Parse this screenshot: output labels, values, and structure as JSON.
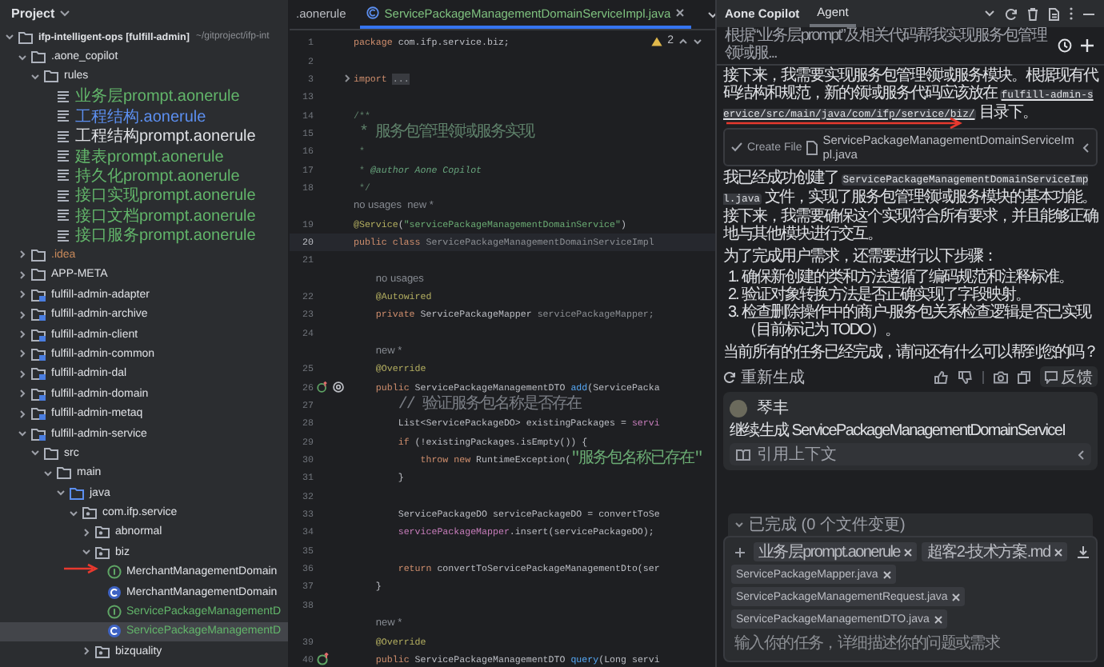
{
  "project_panel": {
    "title": "Project",
    "tree": [
      {
        "name": "ifp-intelligent-ops [fulfill-admin]",
        "path": "~/gitproject/ifp-int",
        "kind": "project",
        "expanded": true,
        "children": [
          {
            "name": ".aone_copilot",
            "kind": "folder",
            "expanded": true,
            "children": [
              {
                "name": "rules",
                "kind": "folder",
                "expanded": true,
                "children": [
                  {
                    "name": "业务层prompt.aonerule",
                    "kind": "rule",
                    "color": "#62b56a"
                  },
                  {
                    "name": "工程结构.aonerule",
                    "kind": "rule",
                    "color": "#5c8ff0"
                  },
                  {
                    "name": "工程结构prompt.aonerule",
                    "kind": "rule",
                    "color": "#dfe1e5"
                  },
                  {
                    "name": "建表prompt.aonerule",
                    "kind": "rule",
                    "color": "#62b56a"
                  },
                  {
                    "name": "持久化prompt.aonerule",
                    "kind": "rule",
                    "color": "#62b56a"
                  },
                  {
                    "name": "接口实现prompt.aonerule",
                    "kind": "rule",
                    "color": "#62b56a"
                  },
                  {
                    "name": "接口文档prompt.aonerule",
                    "kind": "rule",
                    "color": "#62b56a"
                  },
                  {
                    "name": "接口服务prompt.aonerule",
                    "kind": "rule",
                    "color": "#62b56a"
                  }
                ]
              }
            ]
          },
          {
            "name": ".idea",
            "kind": "folder",
            "expanded": false,
            "color": "#c98a5b"
          },
          {
            "name": "APP-META",
            "kind": "folder",
            "expanded": false
          },
          {
            "name": "fulfill-admin-adapter",
            "kind": "module",
            "expanded": false
          },
          {
            "name": "fulfill-admin-archive",
            "kind": "module",
            "expanded": false
          },
          {
            "name": "fulfill-admin-client",
            "kind": "module",
            "expanded": false
          },
          {
            "name": "fulfill-admin-common",
            "kind": "module",
            "expanded": false
          },
          {
            "name": "fulfill-admin-dal",
            "kind": "module",
            "expanded": false
          },
          {
            "name": "fulfill-admin-domain",
            "kind": "module",
            "expanded": false
          },
          {
            "name": "fulfill-admin-metaq",
            "kind": "module",
            "expanded": false
          },
          {
            "name": "fulfill-admin-service",
            "kind": "module",
            "expanded": true,
            "children": [
              {
                "name": "src",
                "kind": "folder",
                "expanded": true,
                "children": [
                  {
                    "name": "main",
                    "kind": "folder",
                    "expanded": true,
                    "children": [
                      {
                        "name": "java",
                        "kind": "source",
                        "expanded": true,
                        "children": [
                          {
                            "name": "com.ifp.service",
                            "kind": "package",
                            "expanded": true,
                            "children": [
                              {
                                "name": "abnormal",
                                "kind": "package",
                                "expanded": false
                              },
                              {
                                "name": "biz",
                                "kind": "package",
                                "expanded": true,
                                "children": [
                                  {
                                    "name": "MerchantManagementDomain",
                                    "kind": "interface",
                                    "selected": false,
                                    "color": "#dfe1e5"
                                  },
                                  {
                                    "name": "MerchantManagementDomain",
                                    "kind": "class",
                                    "selected": false,
                                    "color": "#dfe1e5"
                                  },
                                  {
                                    "name": "ServicePackageManagementD",
                                    "kind": "interface",
                                    "selected": false,
                                    "color": "#62b56a"
                                  },
                                  {
                                    "name": "ServicePackageManagementD",
                                    "kind": "class",
                                    "selected": true,
                                    "color": "#62b56a"
                                  }
                                ]
                              },
                              {
                                "name": "bizquality",
                                "kind": "package",
                                "expanded": false
                              }
                            ]
                          }
                        ]
                      }
                    ]
                  }
                ]
              }
            ]
          }
        ]
      }
    ]
  },
  "editor": {
    "tabs": [
      {
        "label": ".aonerule",
        "kind": "rule",
        "selected": false
      },
      {
        "label": "ServicePackageManagementDomainServiceImpl.java",
        "kind": "class",
        "selected": true
      }
    ],
    "warning_count": "2",
    "lines": [
      {
        "number": "1",
        "current": false,
        "tokens": [
          {
            "text": "package",
            "kind": "keyword"
          },
          {
            "text": " com.ifp.service.biz;",
            "kind": "plain"
          }
        ]
      },
      {
        "number": "2",
        "current": false
      },
      {
        "number": "3",
        "current": false,
        "folded": true,
        "tokens": [
          {
            "text": "import ",
            "kind": "keyword"
          },
          {
            "text": "...",
            "kind": "fold"
          }
        ]
      },
      {
        "number": "13",
        "current": false
      },
      {
        "number": "14",
        "current": false,
        "tokens": [
          {
            "text": "/**",
            "kind": "doc"
          }
        ]
      },
      {
        "number": "15",
        "current": false,
        "tokens": [
          {
            "text": " * 服务包管理领域服务实现",
            "kind": "doc"
          }
        ]
      },
      {
        "number": "16",
        "current": false,
        "tokens": [
          {
            "text": " *",
            "kind": "doc"
          }
        ]
      },
      {
        "number": "17",
        "current": false,
        "tokens": [
          {
            "text": " * ",
            "kind": "doc"
          },
          {
            "text": "@author",
            "kind": "doctag"
          },
          {
            "text": " Aone Copilot",
            "kind": "doctext"
          }
        ]
      },
      {
        "number": "18",
        "current": false,
        "tokens": [
          {
            "text": " */",
            "kind": "doc"
          }
        ]
      },
      {
        "current": false,
        "tokens": [
          {
            "text": "no usages",
            "kind": "hint"
          },
          {
            "text": "  new *",
            "kind": "hint"
          }
        ]
      },
      {
        "number": "19",
        "current": false,
        "tokens": [
          {
            "text": "@Service",
            "kind": "annotation"
          },
          {
            "text": "(",
            "kind": "plain"
          },
          {
            "text": "\"servicePackageManagementDomainService\"",
            "kind": "string"
          },
          {
            "text": ")",
            "kind": "plain"
          }
        ]
      },
      {
        "number": "20",
        "current": true,
        "tokens": [
          {
            "text": "public class ",
            "kind": "keyword"
          },
          {
            "text": "ServicePackageManagementDomainServiceImpl",
            "kind": "unused"
          }
        ]
      },
      {
        "number": "21",
        "current": false
      },
      {
        "current": false,
        "tokens": [
          {
            "text": "    no usages",
            "kind": "hint"
          }
        ]
      },
      {
        "number": "22",
        "current": false,
        "tokens": [
          {
            "text": "    @Autowired",
            "kind": "annotation"
          }
        ]
      },
      {
        "number": "23",
        "current": false,
        "tokens": [
          {
            "text": "    private ",
            "kind": "keyword"
          },
          {
            "text": "ServicePackageMapper ",
            "kind": "plain"
          },
          {
            "text": "servicePackageMapper;",
            "kind": "unused"
          }
        ]
      },
      {
        "number": "24",
        "current": false
      },
      {
        "current": false,
        "tokens": [
          {
            "text": "    new *",
            "kind": "hint"
          }
        ]
      },
      {
        "number": "25",
        "current": false,
        "tokens": [
          {
            "text": "    @Override",
            "kind": "annotation"
          }
        ]
      },
      {
        "number": "26",
        "current": false,
        "gutter": [
          {
            "kind": "override"
          },
          {
            "kind": "ai"
          }
        ],
        "tokens": [
          {
            "text": "    public ",
            "kind": "keyword"
          },
          {
            "text": "ServicePackageManagementDTO ",
            "kind": "plain"
          },
          {
            "text": "add",
            "kind": "method"
          },
          {
            "text": "(ServicePacka",
            "kind": "plain"
          }
        ]
      },
      {
        "number": "27",
        "current": false,
        "tokens": [
          {
            "text": "        // 验证服务包名称是否存在",
            "kind": "comment"
          }
        ]
      },
      {
        "number": "28",
        "current": false,
        "tokens": [
          {
            "text": "        List<ServicePackageDO> existingPackages = ",
            "kind": "plain"
          },
          {
            "text": "servi",
            "kind": "field"
          }
        ]
      },
      {
        "number": "29",
        "current": false,
        "tokens": [
          {
            "text": "        if ",
            "kind": "keyword"
          },
          {
            "text": "(!existingPackages.isEmpty()) {",
            "kind": "plain"
          }
        ]
      },
      {
        "number": "30",
        "current": false,
        "tokens": [
          {
            "text": "            throw new ",
            "kind": "keyword"
          },
          {
            "text": "RuntimeException(",
            "kind": "plain"
          },
          {
            "text": "\"服务包名称已存在\"",
            "kind": "string"
          }
        ]
      },
      {
        "number": "31",
        "current": false,
        "tokens": [
          {
            "text": "        }",
            "kind": "plain"
          }
        ]
      },
      {
        "number": "32",
        "current": false
      },
      {
        "number": "33",
        "current": false,
        "tokens": [
          {
            "text": "        ServicePackageDO servicePackageDO = convertToSe",
            "kind": "plain"
          }
        ]
      },
      {
        "number": "34",
        "current": false,
        "tokens": [
          {
            "text": "        servicePackageMapper",
            "kind": "field"
          },
          {
            "text": ".insert(servicePackageDO);",
            "kind": "plain"
          }
        ]
      },
      {
        "number": "35",
        "current": false
      },
      {
        "number": "36",
        "current": false,
        "tokens": [
          {
            "text": "        return ",
            "kind": "keyword"
          },
          {
            "text": "convertToServicePackageManagementDto(ser",
            "kind": "plain"
          }
        ]
      },
      {
        "number": "37",
        "current": false,
        "tokens": [
          {
            "text": "    }",
            "kind": "plain"
          }
        ]
      },
      {
        "number": "38",
        "current": false
      },
      {
        "current": false,
        "tokens": [
          {
            "text": "    new *",
            "kind": "hint"
          }
        ]
      },
      {
        "number": "39",
        "current": false,
        "tokens": [
          {
            "text": "    @Override",
            "kind": "annotation"
          }
        ]
      },
      {
        "number": "40",
        "current": false,
        "gutter": [
          {
            "kind": "override"
          }
        ],
        "tokens": [
          {
            "text": "    public ",
            "kind": "keyword"
          },
          {
            "text": "ServicePackageManagementDTO ",
            "kind": "plain"
          },
          {
            "text": "query",
            "kind": "method"
          },
          {
            "text": "(Long servi",
            "kind": "plain"
          }
        ]
      }
    ]
  },
  "copilot": {
    "title": "Aone Copilot",
    "tabs": [
      {
        "label": "Agent",
        "selected": true
      }
    ],
    "conversation_title": "根据“业务层prompt”及相关代码帮我实现服务包管理领域服...",
    "blocks": [
      {
        "kind": "paragraph",
        "segments": [
          {
            "kind": "text",
            "text": "接下来，我需要实现服务包管理领域服务模块。根据现有代码结构和规范，新的领域服务代码应该放在 "
          },
          {
            "kind": "path",
            "text": "fulfill-admin-service/src/main/java/com/ifp/service/biz/"
          },
          {
            "kind": "text",
            "text": " 目录下。"
          }
        ]
      },
      {
        "kind": "file-card",
        "action": "Create File",
        "file": "ServicePackageManagementDomainServiceImpl.java"
      },
      {
        "kind": "paragraph",
        "segments": [
          {
            "kind": "text",
            "text": "我已经成功创建了 "
          },
          {
            "kind": "code",
            "text": "ServicePackageManagementDomainServiceImpl.java"
          },
          {
            "kind": "text",
            "text": " 文件，实现了服务包管理领域服务模块的基本功能。接下来，我需要确保这个实现符合所有要求，并且能够正确地与其他模块进行交互。"
          }
        ]
      },
      {
        "kind": "paragraph",
        "segments": [
          {
            "kind": "text",
            "text": "为了完成用户需求，还需要进行以下步骤："
          }
        ]
      },
      {
        "kind": "list",
        "items": [
          {
            "number": "1.",
            "text": "确保新创建的类和方法遵循了编码规范和注释标准。"
          },
          {
            "number": "2.",
            "text": "验证对象转换方法是否正确实现了字段映射。"
          },
          {
            "number": "3.",
            "text": "检查删除操作中的商户-服务包关系检查逻辑是否已实现（目前标记为 TODO）。"
          }
        ]
      },
      {
        "kind": "paragraph",
        "segments": [
          {
            "kind": "text",
            "text": "当前所有的任务已经完成，请问还有什么可以帮到您的吗？"
          }
        ]
      }
    ],
    "response_actions": {
      "regenerate": "重新生成",
      "feedback": "反馈"
    },
    "user_message": {
      "name": "琴丰",
      "text": "继续生成 ServicePackageManagementDomainServiceI",
      "context": "引用上下文"
    },
    "progress": "已完成 (0 个文件变更)",
    "composer": {
      "chips": [
        "业务层prompt.aonerule",
        "超客2-技术方案.md",
        "ServicePackageMapper.java",
        "ServicePackageManagementRequest.java",
        "ServicePackageManagementDTO.java"
      ],
      "placeholder": "输入你的任务，详细描述你的问题或需求"
    }
  }
}
